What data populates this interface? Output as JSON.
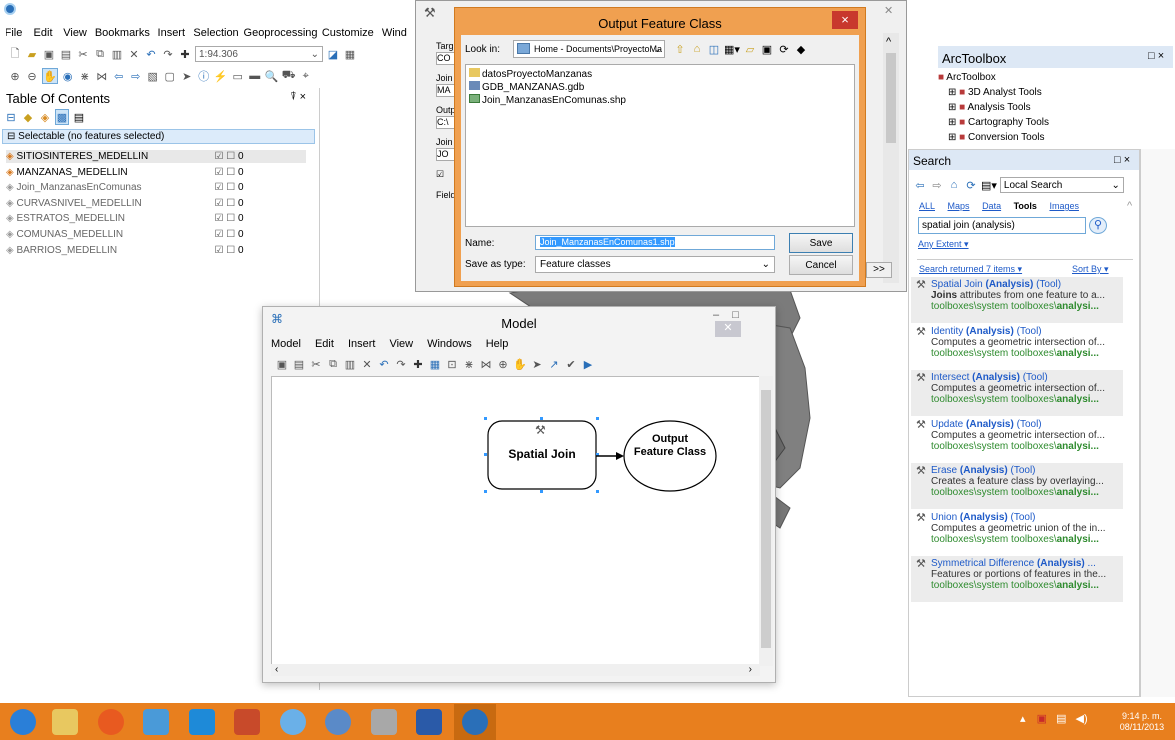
{
  "menubar": {
    "items": [
      "File",
      "Edit",
      "View",
      "Bookmarks",
      "Insert",
      "Selection",
      "Geoprocessing",
      "Customize",
      "Wind"
    ]
  },
  "toolbar": {
    "scale": "1:94.306"
  },
  "toc": {
    "title": "Table Of Contents",
    "pin": "⍒ ×",
    "selectable": "Selectable (no features selected)",
    "layers": [
      {
        "name": "SITIOSINTERES_MEDELLIN",
        "count": "0",
        "active": true
      },
      {
        "name": "MANZANAS_MEDELLIN",
        "count": "0",
        "active": true
      },
      {
        "name": "Join_ManzanasEnComunas",
        "count": "0",
        "active": false
      },
      {
        "name": "CURVASNIVEL_MEDELLIN",
        "count": "0",
        "active": false
      },
      {
        "name": "ESTRATOS_MEDELLIN",
        "count": "0",
        "active": false
      },
      {
        "name": "COMUNAS_MEDELLIN",
        "count": "0",
        "active": false
      },
      {
        "name": "BARRIOS_MEDELLIN",
        "count": "0",
        "active": false
      }
    ]
  },
  "tool_dialog": {
    "labels": [
      "Targ",
      "CO",
      "Join",
      "MA",
      "Outp",
      "C:\\",
      "Join",
      "JO",
      "Field"
    ]
  },
  "output_dialog": {
    "title": "Output Feature Class",
    "close": "×",
    "look_in_label": "Look in:",
    "look_in_value": "Home - Documents\\ProyectoMa",
    "files": [
      "datosProyectoManzanas",
      "GDB_MANZANAS.gdb",
      "Join_ManzanasEnComunas.shp"
    ],
    "name_label": "Name:",
    "name_value": "Join_ManzanasEnComunas1.shp",
    "save_type_label": "Save as type:",
    "save_type_value": "Feature classes",
    "save_button": "Save",
    "cancel_button": "Cancel",
    "more": ">>"
  },
  "model": {
    "title": "Model",
    "menu": [
      "Model",
      "Edit",
      "Insert",
      "View",
      "Windows",
      "Help"
    ],
    "tool_node": "Spatial Join",
    "output_node": "Output Feature Class"
  },
  "arctoolbox": {
    "title": "ArcToolbox",
    "close": "□ ×",
    "root": "ArcToolbox",
    "items": [
      "3D Analyst Tools",
      "Analysis Tools",
      "Cartography Tools",
      "Conversion Tools"
    ]
  },
  "search": {
    "title": "Search",
    "close": "□ ×",
    "scope": "Local Search",
    "filters": [
      "ALL",
      "Maps",
      "Data",
      "Tools",
      "Images"
    ],
    "query": "spatial join (analysis)",
    "extent": "Any Extent",
    "returned": "Search returned 7 items",
    "sort": "Sort By",
    "results": [
      {
        "name": "Spatial Join",
        "tag": "(Analysis)",
        "kind": "(Tool)",
        "desc_b": "Joins",
        "desc": " attributes from one feature to a...",
        "path": "toolboxes\\system toolboxes\\",
        "path_b": "analysi..."
      },
      {
        "name": "Identity",
        "tag": "(Analysis)",
        "kind": "(Tool)",
        "desc_b": "",
        "desc": "Computes a geometric intersection of...",
        "path": "toolboxes\\system toolboxes\\",
        "path_b": "analysi..."
      },
      {
        "name": "Intersect",
        "tag": "(Analysis)",
        "kind": "(Tool)",
        "desc_b": "",
        "desc": "Computes a geometric intersection of...",
        "path": "toolboxes\\system toolboxes\\",
        "path_b": "analysi..."
      },
      {
        "name": "Update",
        "tag": "(Analysis)",
        "kind": "(Tool)",
        "desc_b": "",
        "desc": "Computes a geometric intersection of...",
        "path": "toolboxes\\system toolboxes\\",
        "path_b": "analysi..."
      },
      {
        "name": "Erase",
        "tag": "(Analysis)",
        "kind": "(Tool)",
        "desc_b": "",
        "desc": "Creates a feature class by overlaying...",
        "path": "toolboxes\\system toolboxes\\",
        "path_b": "analysi..."
      },
      {
        "name": "Union",
        "tag": "(Analysis)",
        "kind": "(Tool)",
        "desc_b": "",
        "desc": "Computes a geometric union of the in...",
        "path": "toolboxes\\system toolboxes\\",
        "path_b": "analysi..."
      },
      {
        "name": "Symmetrical Difference",
        "tag": "(Analysis)",
        "kind": "...",
        "desc_b": "",
        "desc": "Features or portions of features in the...",
        "path": "toolboxes\\system toolboxes\\",
        "path_b": "analysi..."
      }
    ]
  },
  "taskbar": {
    "time": "9:14 p. m.",
    "date": "08/11/2013",
    "apps": [
      "internet-explorer",
      "file-explorer",
      "firefox",
      "arccatalog",
      "skype",
      "powerpoint",
      "paint",
      "chrome",
      "snipping-tool",
      "word",
      "arcmap"
    ]
  },
  "colors": {
    "accent": "#3399ff",
    "dialog_frame": "#f0a050",
    "taskbar": "#e87f1e",
    "search_blue": "#1e5ac8",
    "path_green": "#2e8b2e",
    "map_gray": "#808080"
  }
}
